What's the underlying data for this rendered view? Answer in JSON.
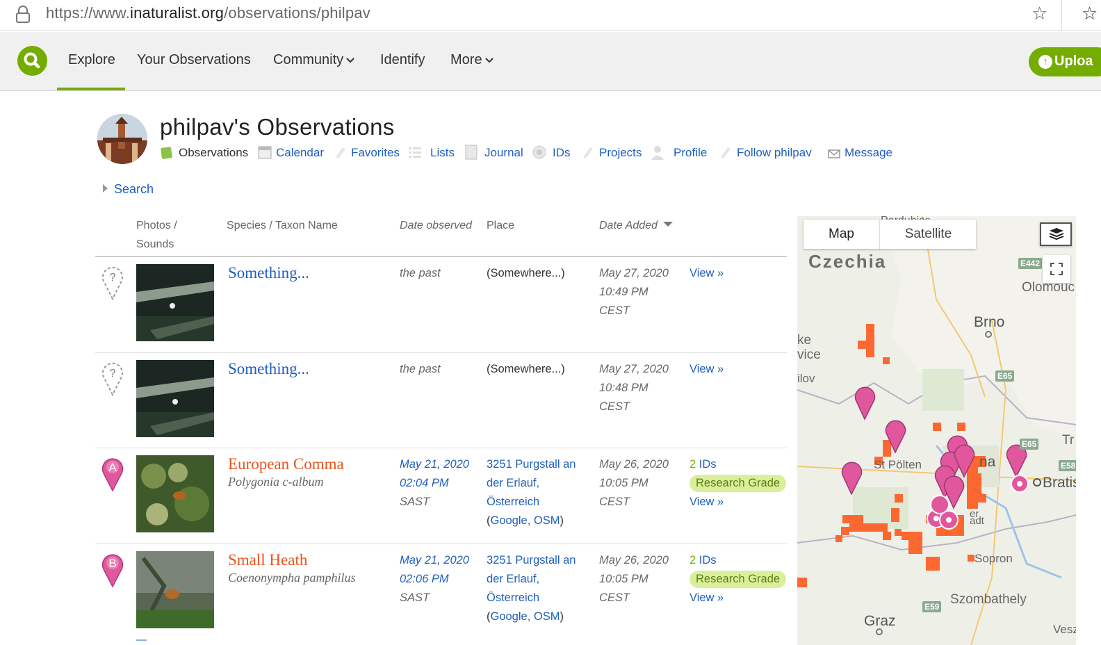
{
  "browser": {
    "url_prefix": "https://www.",
    "url_host": "inaturalist.org",
    "url_path": "/observations/philpav"
  },
  "nav": {
    "items": [
      {
        "label": "Explore"
      },
      {
        "label": "Your Observations"
      },
      {
        "label": "Community"
      },
      {
        "label": "Identify"
      },
      {
        "label": "More"
      }
    ],
    "active": "Explore",
    "upload_label": "Uploa"
  },
  "header": {
    "title": "philpav's Observations",
    "subnav": [
      {
        "label": "Observations",
        "icon": "observations-icon"
      },
      {
        "label": "Calendar",
        "icon": "calendar-icon"
      },
      {
        "label": "Favorites",
        "icon": "favorites-icon"
      },
      {
        "label": "Lists",
        "icon": "lists-icon"
      },
      {
        "label": "Journal",
        "icon": "journal-icon"
      },
      {
        "label": "IDs",
        "icon": "ids-icon"
      },
      {
        "label": "Projects",
        "icon": "projects-icon"
      },
      {
        "label": "Profile",
        "icon": "profile-icon"
      },
      {
        "label": "Follow philpav",
        "icon": "follow-icon"
      },
      {
        "label": "Message",
        "icon": "message-icon"
      }
    ],
    "current": "Observations"
  },
  "search_toggle": "Search",
  "table": {
    "columns": {
      "photos_1": "Photos /",
      "photos_2": "Sounds",
      "species": "Species / Taxon Name",
      "date_observed": "Date observed",
      "place": "Place",
      "date_added": "Date Added"
    },
    "rows": [
      {
        "marker": "?",
        "common_name": "Something...",
        "scientific_name": "",
        "date_observed": [
          "the past"
        ],
        "place": [
          "(Somewhere...)"
        ],
        "date_added": [
          "May 27, 2020",
          "10:49 PM",
          "CEST"
        ],
        "ids": "",
        "quality": "",
        "view": "View »"
      },
      {
        "marker": "?",
        "common_name": "Something...",
        "scientific_name": "",
        "date_observed": [
          "the past"
        ],
        "place": [
          "(Somewhere...)"
        ],
        "date_added": [
          "May 27, 2020",
          "10:48 PM",
          "CEST"
        ],
        "ids": "",
        "quality": "",
        "view": "View »"
      },
      {
        "marker": "A",
        "common_name": "European Comma",
        "scientific_name": "Polygonia c-album",
        "date_observed": [
          "May 21, 2020",
          "02:04 PM",
          "SAST"
        ],
        "place": [
          "3251 Purgstall an",
          "der Erlauf,",
          "Österreich"
        ],
        "place_links": {
          "open": "(",
          "google": "Google",
          "sep": ", ",
          "osm": "OSM",
          "close": ")"
        },
        "date_added": [
          "May 26, 2020",
          "10:05 PM",
          "CEST"
        ],
        "ids_count": "2",
        "ids_label": " IDs",
        "quality": "Research Grade",
        "view": "View »"
      },
      {
        "marker": "B",
        "common_name": "Small Heath",
        "scientific_name": "Coenonympha pamphilus",
        "date_observed": [
          "May 21, 2020",
          "02:06 PM",
          "SAST"
        ],
        "place": [
          "3251 Purgstall an",
          "der Erlauf,",
          "Österreich"
        ],
        "place_links": {
          "open": "(",
          "google": "Google",
          "sep": ", ",
          "osm": "OSM",
          "close": ")"
        },
        "date_added": [
          "May 26, 2020",
          "10:05 PM",
          "CEST"
        ],
        "ids_count": "2",
        "ids_label": " IDs",
        "quality": "Research Grade",
        "view": "View »"
      }
    ]
  },
  "map": {
    "tab_map": "Map",
    "tab_satellite": "Satellite",
    "labels": {
      "czechia": "Czechia",
      "pardubice": "Pardubice",
      "olomouc": "Olomouc",
      "brno": "Brno",
      "ke": "ke",
      "vice": "vice",
      "ilov": "ilov",
      "stpolten": "St Pölten",
      "na": "na",
      "bratis": "Bratis",
      "tr": "Tr",
      "sopron": "Sopron",
      "szombathely": "Szombathely",
      "graz": "Graz",
      "ves": "Vesz",
      "adt": "adt",
      "er": "er"
    },
    "roads": {
      "e442": "E442",
      "e65a": "E65",
      "e65b": "E65",
      "e58": "E58",
      "e59": "E59"
    }
  },
  "colors": {
    "brand_green": "#74ac00",
    "link_blue": "#1f5fbf",
    "name_orange": "#e8541e",
    "research_grade_bg": "#dbef9b",
    "marker_pink": "#e0579d",
    "heat_orange": "#ff5a1f"
  }
}
